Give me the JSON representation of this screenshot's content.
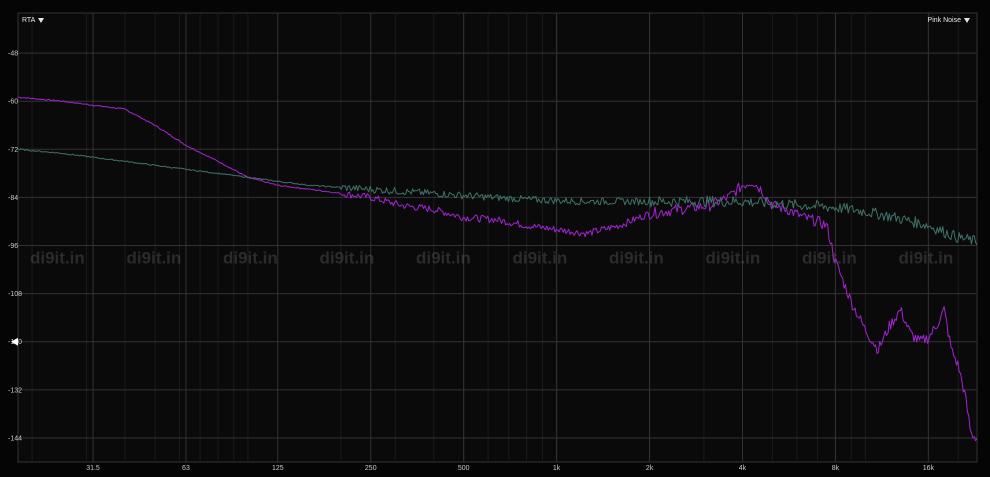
{
  "header": {
    "mode_label": "RTA",
    "signal_label": "Pink Noise"
  },
  "watermark": "di9it.in",
  "colors": {
    "background": "#0a0a0a",
    "grid": "#333333",
    "series_measured": "#a622d6",
    "series_reference": "#3f7268"
  },
  "chart_data": {
    "type": "line",
    "x_scale": "log",
    "xlim": [
      18,
      23000
    ],
    "ylim": [
      -150,
      -38
    ],
    "x_ticks": [
      31.5,
      63,
      125,
      250,
      500,
      1000,
      2000,
      4000,
      8000,
      16000
    ],
    "x_tick_labels": [
      "31.5",
      "63",
      "125",
      "250",
      "500",
      "1k",
      "2k",
      "4k",
      "8k",
      "16k"
    ],
    "y_ticks": [
      -48,
      -60,
      -72,
      -84,
      -96,
      -108,
      -120,
      -132,
      -144
    ],
    "y_tick_labels": [
      "-48",
      "-60",
      "-72",
      "-84",
      "-96",
      "-108",
      "-120",
      "-132",
      "-144"
    ],
    "marker_level": -120,
    "grid": true,
    "series": [
      {
        "color": "#a622d6",
        "x": [
          18,
          25,
          31.5,
          40,
          50,
          63,
          80,
          100,
          125,
          160,
          200,
          250,
          315,
          400,
          500,
          630,
          800,
          1000,
          1250,
          1600,
          2000,
          2500,
          3150,
          3600,
          4000,
          4300,
          4600,
          5000,
          5600,
          6300,
          7000,
          7500,
          8000,
          9000,
          10000,
          11000,
          12000,
          13000,
          14000,
          15000,
          16000,
          17000,
          18000,
          19000,
          20000,
          21000,
          22000,
          23000
        ],
        "y": [
          -59,
          -60,
          -61,
          -62,
          -66,
          -71,
          -75,
          -79,
          -81,
          -82,
          -83,
          -84,
          -86,
          -87,
          -89,
          -89.5,
          -91,
          -92,
          -93,
          -91,
          -88,
          -87,
          -86,
          -84,
          -81,
          -80,
          -82,
          -86,
          -87,
          -89,
          -90,
          -91,
          -100,
          -110,
          -117,
          -122,
          -116,
          -112,
          -118,
          -120,
          -119,
          -116,
          -112,
          -122,
          -126,
          -133,
          -143,
          -144
        ]
      },
      {
        "color": "#3f7268",
        "x": [
          18,
          25,
          31.5,
          40,
          50,
          63,
          80,
          100,
          125,
          160,
          200,
          250,
          315,
          400,
          500,
          630,
          800,
          1000,
          1250,
          1600,
          2000,
          2500,
          3150,
          4000,
          5000,
          6300,
          8000,
          10000,
          12500,
          16000,
          20000,
          23000
        ],
        "y": [
          -72,
          -73,
          -74,
          -75,
          -76,
          -77,
          -78,
          -79,
          -80,
          -81,
          -81.5,
          -82,
          -82.5,
          -83,
          -83.5,
          -84,
          -84.5,
          -84.8,
          -85,
          -85,
          -85,
          -85,
          -85,
          -85,
          -85.5,
          -86,
          -86.5,
          -87.5,
          -89,
          -91,
          -94,
          -95
        ]
      }
    ]
  }
}
